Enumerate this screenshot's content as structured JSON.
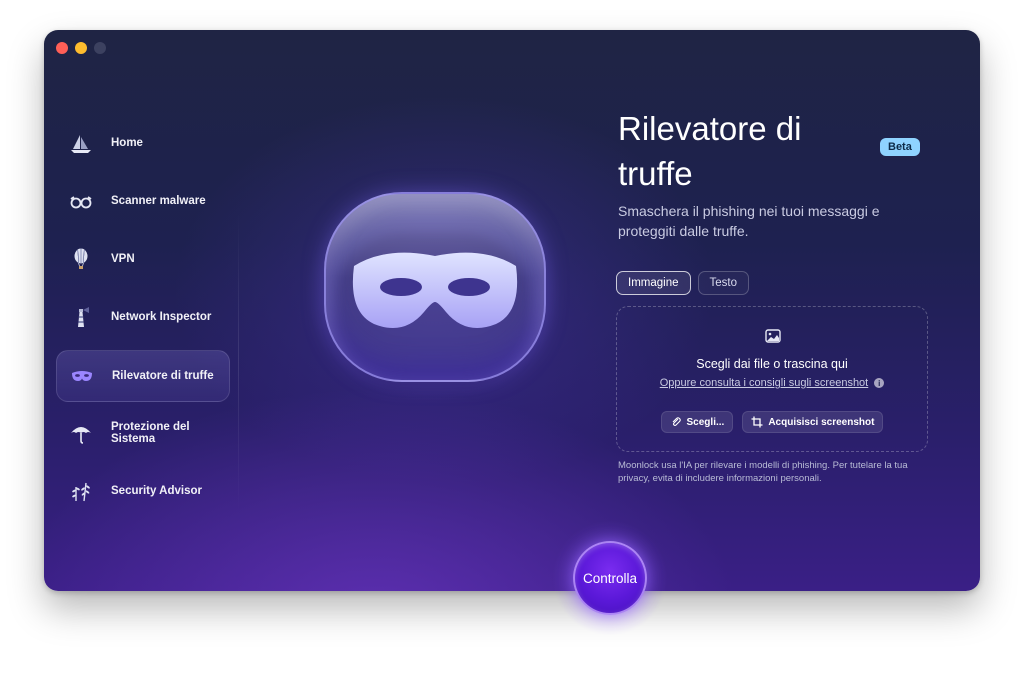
{
  "window": {
    "traffic_lights": [
      "close",
      "minimize",
      "zoom"
    ]
  },
  "sidebar": {
    "items": [
      {
        "label": "Home",
        "icon": "sailboat-icon",
        "active": false
      },
      {
        "label": "Scanner malware",
        "icon": "glasses-icon",
        "active": false
      },
      {
        "label": "VPN",
        "icon": "balloon-icon",
        "active": false
      },
      {
        "label": "Network Inspector",
        "icon": "lighthouse-icon",
        "active": false
      },
      {
        "label": "Rilevatore di truffe",
        "icon": "mask-icon",
        "active": true
      },
      {
        "label": "Protezione del Sistema",
        "icon": "umbrella-icon",
        "active": false
      },
      {
        "label": "Security Advisor",
        "icon": "leaves-icon",
        "active": false
      }
    ]
  },
  "hero": {
    "icon": "mask-icon"
  },
  "main": {
    "title": "Rilevatore di truffe",
    "badge": "Beta",
    "subtitle": "Smaschera il phishing nei tuoi messaggi e proteggiti dalle truffe.",
    "tabs": [
      {
        "label": "Immagine",
        "active": true
      },
      {
        "label": "Testo",
        "active": false
      }
    ],
    "dropzone": {
      "icon": "image-icon",
      "title": "Scegli dai file o trascina qui",
      "link": "Oppure consulta i consigli sugli screenshot",
      "info_icon": "i",
      "choose_button": "Scegli...",
      "screenshot_button": "Acquisisci screenshot"
    },
    "disclaimer": "Moonlock usa l'IA per rilevare i modelli di phishing. Per tutelare la tua privacy, evita di includere informazioni personali."
  },
  "action": {
    "label": "Controlla"
  },
  "colors": {
    "accent": "#5a18d8",
    "badge": "#8fd3ff",
    "background_top": "#1f2444",
    "background_bottom": "#3a1f86"
  }
}
